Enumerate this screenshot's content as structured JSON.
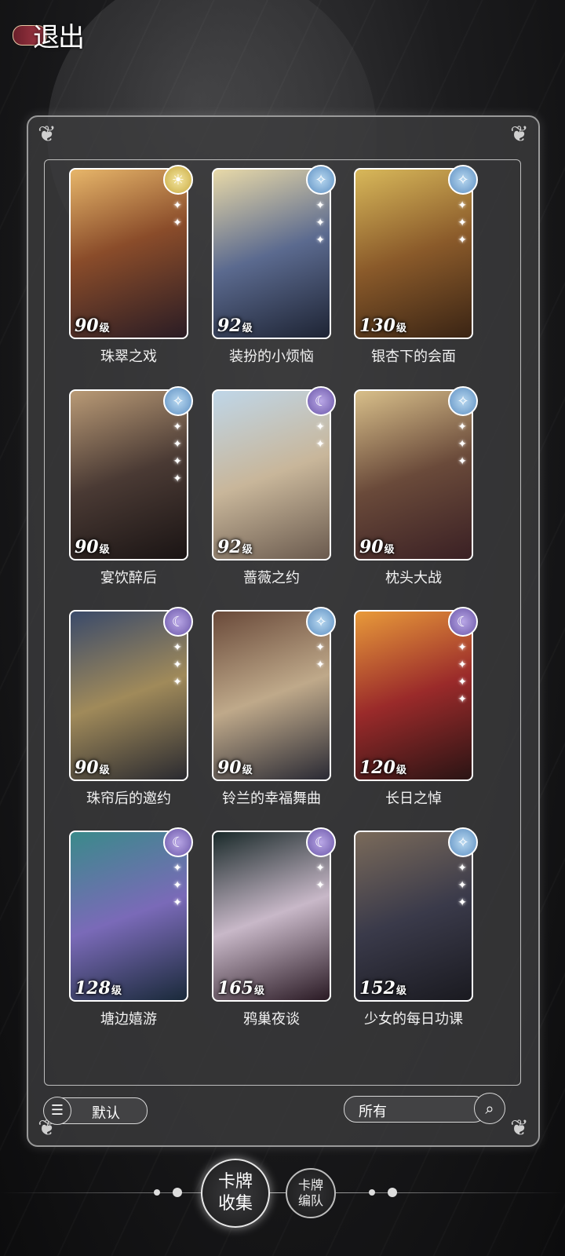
{
  "exit_label": "退出",
  "cards": [
    {
      "name": "珠翠之戏",
      "level": "90",
      "lvl_unit": "级",
      "badge": "sun-icon",
      "sparks": 2,
      "bg": "linear-gradient(160deg,#e7b66a 0%,#8a4c2a 45%,#2a1c24 100%)"
    },
    {
      "name": "装扮的小烦恼",
      "level": "92",
      "lvl_unit": "级",
      "badge": "star-icon",
      "sparks": 3,
      "bg": "linear-gradient(160deg,#e8d9a8 0%,#5b6a8f 50%,#1e2434 100%)"
    },
    {
      "name": "银杏下的会面",
      "level": "130",
      "lvl_unit": "级",
      "badge": "star-icon",
      "sparks": 3,
      "bg": "linear-gradient(160deg,#d8b85a 0%,#8a5a2a 50%,#3a2414 100%)"
    },
    {
      "name": "宴饮醉后",
      "level": "90",
      "lvl_unit": "级",
      "badge": "star-icon",
      "sparks": 4,
      "bg": "linear-gradient(160deg,#b99a76 0%,#4a3a34 50%,#1a1414 100%)"
    },
    {
      "name": "蔷薇之约",
      "level": "92",
      "lvl_unit": "级",
      "badge": "moon-icon",
      "sparks": 2,
      "bg": "linear-gradient(160deg,#bfd6e8 0%,#c8b69a 50%,#6a5a4e 100%)"
    },
    {
      "name": "枕头大战",
      "level": "90",
      "lvl_unit": "级",
      "badge": "star-icon",
      "sparks": 3,
      "bg": "linear-gradient(160deg,#d8bf8a 0%,#6a4a3a 50%,#3a2024 100%)"
    },
    {
      "name": "珠帘后的邀约",
      "level": "90",
      "lvl_unit": "级",
      "badge": "moon-icon",
      "sparks": 3,
      "bg": "linear-gradient(160deg,#3a4a6a 0%,#a08a5a 50%,#2a2a30 100%)"
    },
    {
      "name": "铃兰的幸福舞曲",
      "level": "90",
      "lvl_unit": "级",
      "badge": "star-icon",
      "sparks": 2,
      "bg": "linear-gradient(160deg,#6a4a3a 0%,#bfa98a 50%,#2a2a34 100%)"
    },
    {
      "name": "长日之悼",
      "level": "120",
      "lvl_unit": "级",
      "badge": "moon-icon",
      "sparks": 4,
      "bg": "linear-gradient(160deg,#e89a3a 0%,#9a2a2a 50%,#2a1414 100%)"
    },
    {
      "name": "塘边嬉游",
      "level": "128",
      "lvl_unit": "级",
      "badge": "moon-icon",
      "sparks": 3,
      "bg": "linear-gradient(160deg,#3a8a8a 0%,#7a6ab8 50%,#1a2a3a 100%)"
    },
    {
      "name": "鸦巢夜谈",
      "level": "165",
      "lvl_unit": "级",
      "badge": "moon-icon",
      "sparks": 2,
      "bg": "linear-gradient(160deg,#1a2a2a 0%,#c8b8c8 50%,#2a1a24 100%)"
    },
    {
      "name": "少女的每日功课",
      "level": "152",
      "lvl_unit": "级",
      "badge": "star-icon",
      "sparks": 3,
      "bg": "linear-gradient(160deg,#7a6a5a 0%,#3a3a4a 50%,#1a1a20 100%)"
    }
  ],
  "sort": {
    "label": "默认",
    "icon": "sort-list-icon"
  },
  "filter": {
    "label": "所有",
    "icon": "search-icon"
  },
  "tabs": {
    "main_line1": "卡牌",
    "main_line2": "收集",
    "sec_line1": "卡牌",
    "sec_line2": "编队"
  }
}
